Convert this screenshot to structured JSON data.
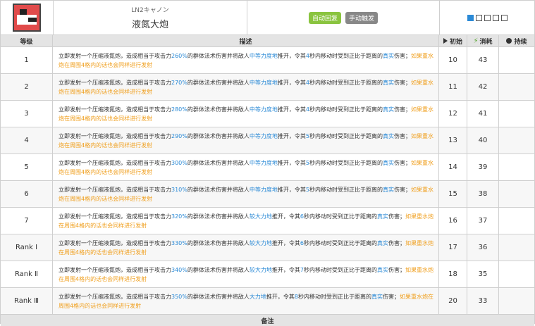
{
  "header": {
    "subtitle": "LN2キャノン",
    "title": "液氮大炮",
    "tag_auto": "自动回复",
    "tag_manual": "手动触发",
    "levels": 5,
    "level_active": 1
  },
  "columns": {
    "level": "等级",
    "desc": "描述",
    "init": "初始",
    "cost": "消耗",
    "duration": "持续",
    "footer": "备注"
  },
  "text": {
    "p1": "立即发射一个压缩液氮炮，造成相当于攻击力",
    "p2": "的群体法术伤害并将敌人",
    "p3": "推开，令其",
    "p4": "秒内移动时受到正比于距离的",
    "p4b": "秒内移动时受",
    "p4c": "到正比于距离的",
    "true_dmg": "真实",
    "p5": "伤害；",
    "note": "如果重水炮在周围4格内的话也会同样进行发射"
  },
  "rows": [
    {
      "level": "1",
      "pct": "260%",
      "force": "中等力度地",
      "sec": "4",
      "init": "10",
      "cost": "43",
      "duration": ""
    },
    {
      "level": "2",
      "pct": "270%",
      "force": "中等力度地",
      "sec": "4",
      "init": "11",
      "cost": "42",
      "duration": ""
    },
    {
      "level": "3",
      "pct": "280%",
      "force": "中等力度地",
      "sec": "4",
      "init": "12",
      "cost": "41",
      "duration": ""
    },
    {
      "level": "4",
      "pct": "290%",
      "force": "中等力度地",
      "sec": "5",
      "init": "13",
      "cost": "40",
      "duration": ""
    },
    {
      "level": "5",
      "pct": "300%",
      "force": "中等力度地",
      "sec": "5",
      "init": "14",
      "cost": "39",
      "duration": ""
    },
    {
      "level": "6",
      "pct": "310%",
      "force": "中等力度地",
      "sec": "5",
      "init": "15",
      "cost": "38",
      "duration": ""
    },
    {
      "level": "7",
      "pct": "320%",
      "force": "较大力地",
      "sec": "6",
      "init": "16",
      "cost": "37",
      "duration": ""
    },
    {
      "level": "Rank Ⅰ",
      "pct": "330%",
      "force": "较大力地",
      "sec": "6",
      "init": "17",
      "cost": "36",
      "duration": ""
    },
    {
      "level": "Rank Ⅱ",
      "pct": "340%",
      "force": "较大力地",
      "sec": "7",
      "init": "18",
      "cost": "35",
      "duration": ""
    },
    {
      "level": "Rank Ⅲ",
      "pct": "350%",
      "force": "大力地",
      "sec": "8",
      "init": "20",
      "cost": "33",
      "duration": ""
    }
  ],
  "colors": {
    "accent_blue": "#2b8ad6",
    "note_orange": "#f0a020",
    "tag_green": "#8ac43f"
  },
  "icons": {
    "skill": "skill-cannon-icon",
    "init": "play-triangle-icon",
    "cost": "lightning-icon",
    "duration": "clock-icon"
  }
}
